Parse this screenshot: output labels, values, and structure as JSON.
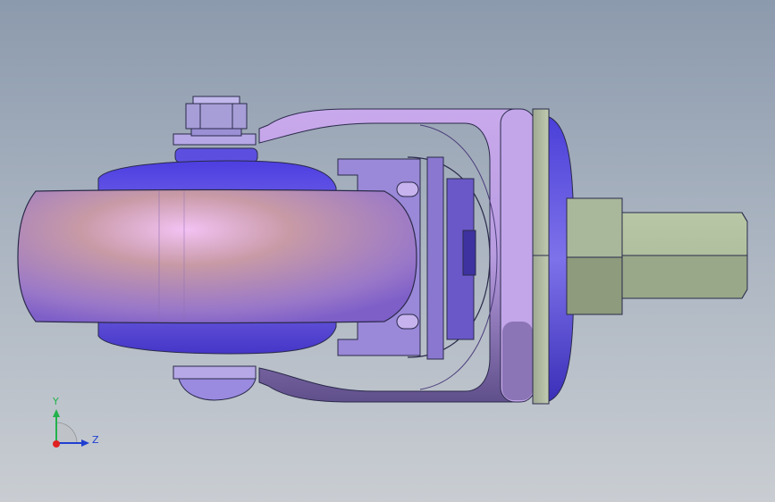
{
  "viewport": {
    "background_top": "#8c9aad",
    "background_bottom": "#c9cdd2"
  },
  "model": {
    "description_icon": "caster-wheel-assembly",
    "colors": {
      "wheel_tread": "#c18e9c",
      "wheel_highlight": "#eeb9ee",
      "hub": "#6a5ae0",
      "fork": "#b8a0e0",
      "fork_shadow": "#7a63b0",
      "plate": "#a9b59a",
      "stem": "#a8b896",
      "nut": "#a79ed8"
    }
  },
  "triad": {
    "y_label": "Y",
    "z_label": "Z",
    "y_color": "#22b14c",
    "z_color": "#1f3fd0",
    "x_color": "#e02020"
  }
}
